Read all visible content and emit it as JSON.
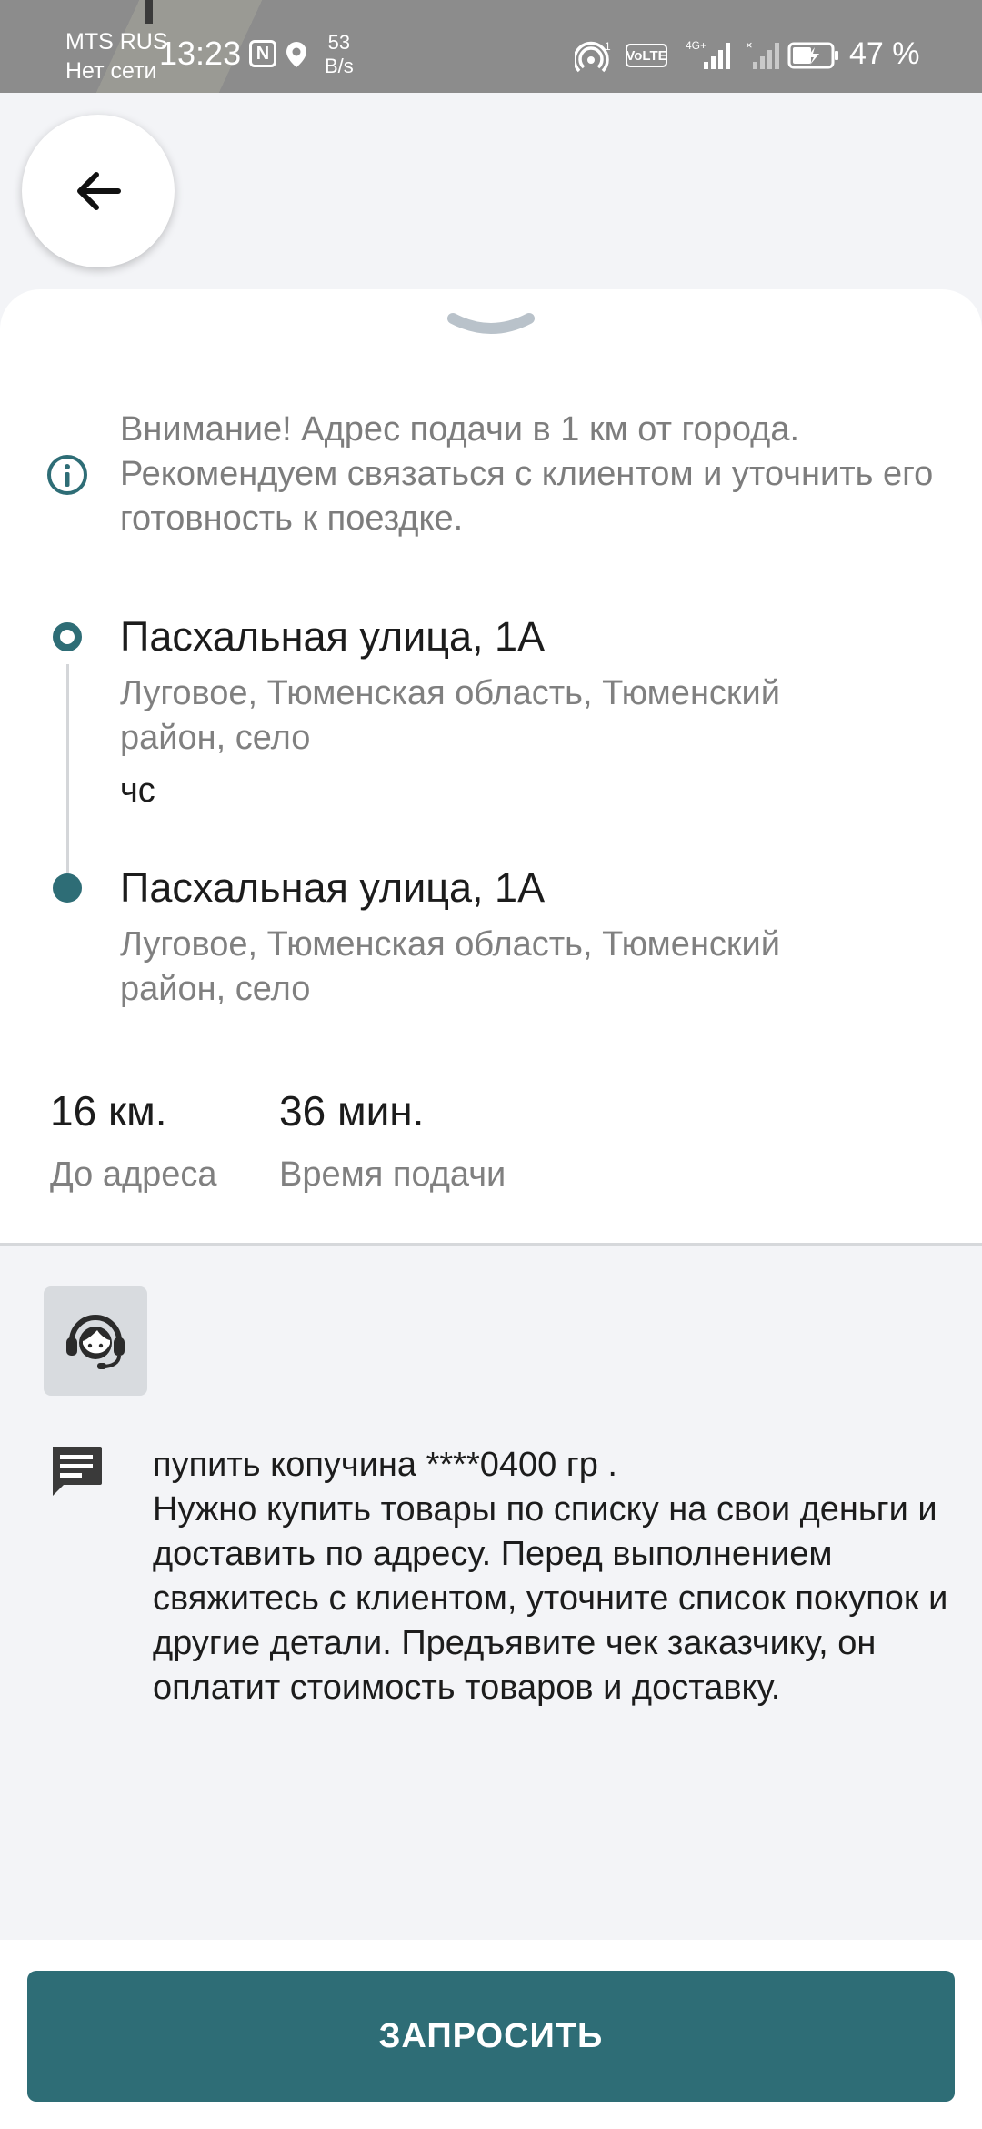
{
  "status_bar": {
    "carrier": "MTS RUS",
    "network_status": "Нет сети",
    "time": "13:23",
    "speed_value": "53",
    "speed_unit": "B/s",
    "battery": "47 %",
    "icons": [
      "nfc-icon",
      "location-icon",
      "hotspot-icon",
      "volte-icon",
      "signal-4g-icon",
      "signal-no-service-icon",
      "battery-charging-icon"
    ]
  },
  "header": {
    "back_icon": "arrow-left-icon"
  },
  "sheet": {
    "handle_icon": "chevron-down-icon",
    "warning": {
      "icon": "info-icon",
      "text": "Внимание! Адрес подачи в 1 км от города. Рекомендуем связаться с клиентом и уточнить его готовность к поездке."
    },
    "route": {
      "pickup": {
        "title": "Пасхальная улица, 1А",
        "subtitle": "Луговое, Тюменская область, Тюменский район, село",
        "note": "чс"
      },
      "dropoff": {
        "title": "Пасхальная улица, 1А",
        "subtitle": "Луговое, Тюменская область, Тюменский район, село"
      }
    },
    "stats": {
      "distance_value": "16 км.",
      "distance_label": "До адреса",
      "time_value": "36 мин.",
      "time_label": "Время подачи"
    }
  },
  "details": {
    "support_icon": "support-agent-icon",
    "comment_icon": "comment-icon",
    "comment_text": "пупить копучина ****0400 гр .\nНужно купить товары по списку на свои деньги и доставить по адресу. Перед выполнением свяжитесь с клиентом, уточните список покупок и другие детали. Предъявите чек заказчику, он оплатит стоимость товаров и доставку."
  },
  "footer": {
    "request_label": "ЗАПРОСИТЬ"
  },
  "colors": {
    "accent": "#2e6d76",
    "status_bar": "#8c8c8c",
    "secondary_text": "#7d7d7d",
    "lower_background": "#f3f4f7"
  }
}
